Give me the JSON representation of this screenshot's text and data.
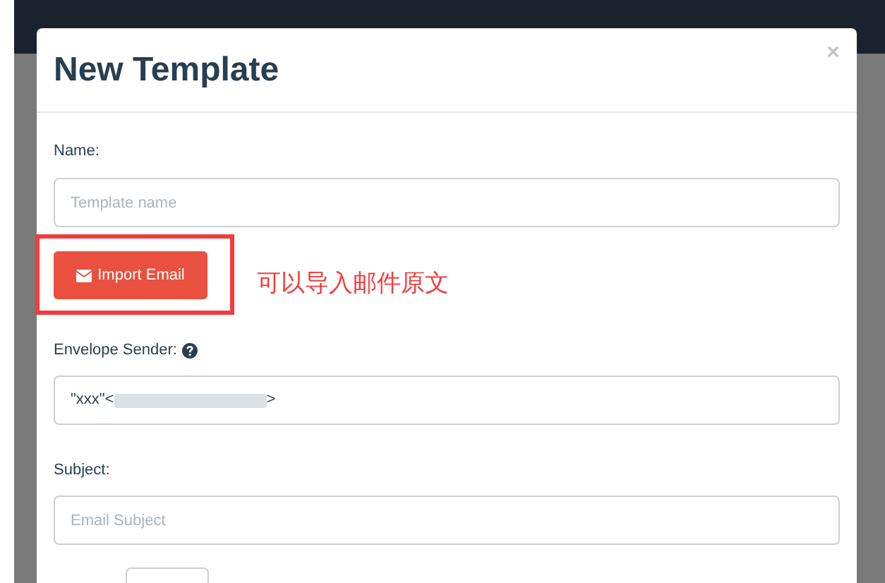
{
  "modal": {
    "title": "New Template",
    "close": "×"
  },
  "name_field": {
    "label": "Name:",
    "placeholder": "Template name"
  },
  "import_button": {
    "label": "Import Email"
  },
  "annotation": "可以导入邮件原文",
  "envelope_sender": {
    "label": "Envelope Sender:",
    "value_start": "\"xxx\"<",
    "value_end": ">"
  },
  "subject_field": {
    "label": "Subject:",
    "placeholder": "Email Subject"
  }
}
